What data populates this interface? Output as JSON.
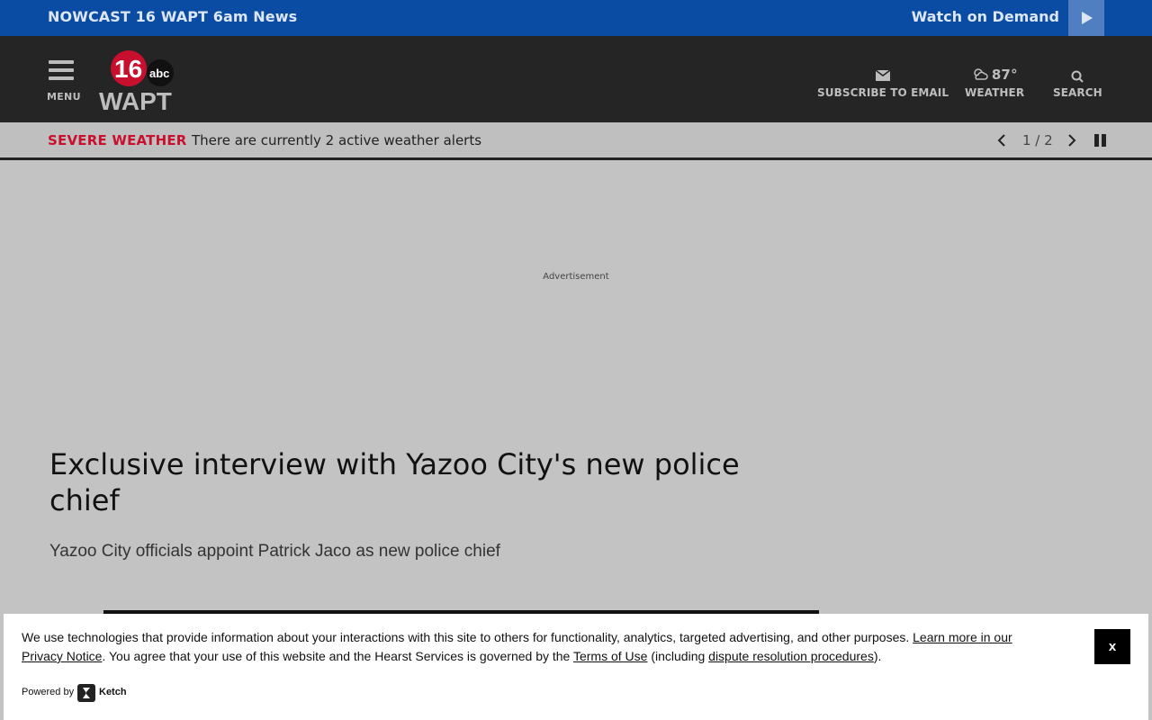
{
  "topbar": {
    "live_label": "NOWCAST 16 WAPT 6am News",
    "watch_label": "Watch on Demand"
  },
  "header": {
    "menu_label": "MENU",
    "logo_number": "16",
    "logo_network": "abc",
    "logo_call": "WAPT",
    "subscribe_label": "SUBSCRIBE TO EMAIL",
    "temperature": "87°",
    "weather_label": "WEATHER",
    "search_label": "SEARCH"
  },
  "alert": {
    "title": "SEVERE WEATHER",
    "message": "There are currently 2 active weather alerts",
    "pager": "1 / 2"
  },
  "ad_label": "Advertisement",
  "article": {
    "headline": "Exclusive interview with Yazoo City's new police chief",
    "subhead": "Yazoo City officials appoint Patrick Jaco as new police chief"
  },
  "cookie": {
    "text_1": "We use technologies that provide information about your interactions with this site to others for functionality, analytics, targeted advertising, and other purposes. ",
    "privacy_link": "Learn more in our Privacy Notice",
    "text_2": ". You agree that your use of this website and the Hearst Services is governed by the ",
    "terms_link": "Terms of Use",
    "text_3": " (including ",
    "dispute_link": "dispute resolution procedures",
    "text_4": ").",
    "close_label": "x",
    "powered_label": "Powered by",
    "brand": "Ketch"
  },
  "colors": {
    "topbar_bg": "#0a4ba3",
    "header_bg": "#252525",
    "alert_red": "#c8102e",
    "page_bg": "#c3c3c3"
  }
}
